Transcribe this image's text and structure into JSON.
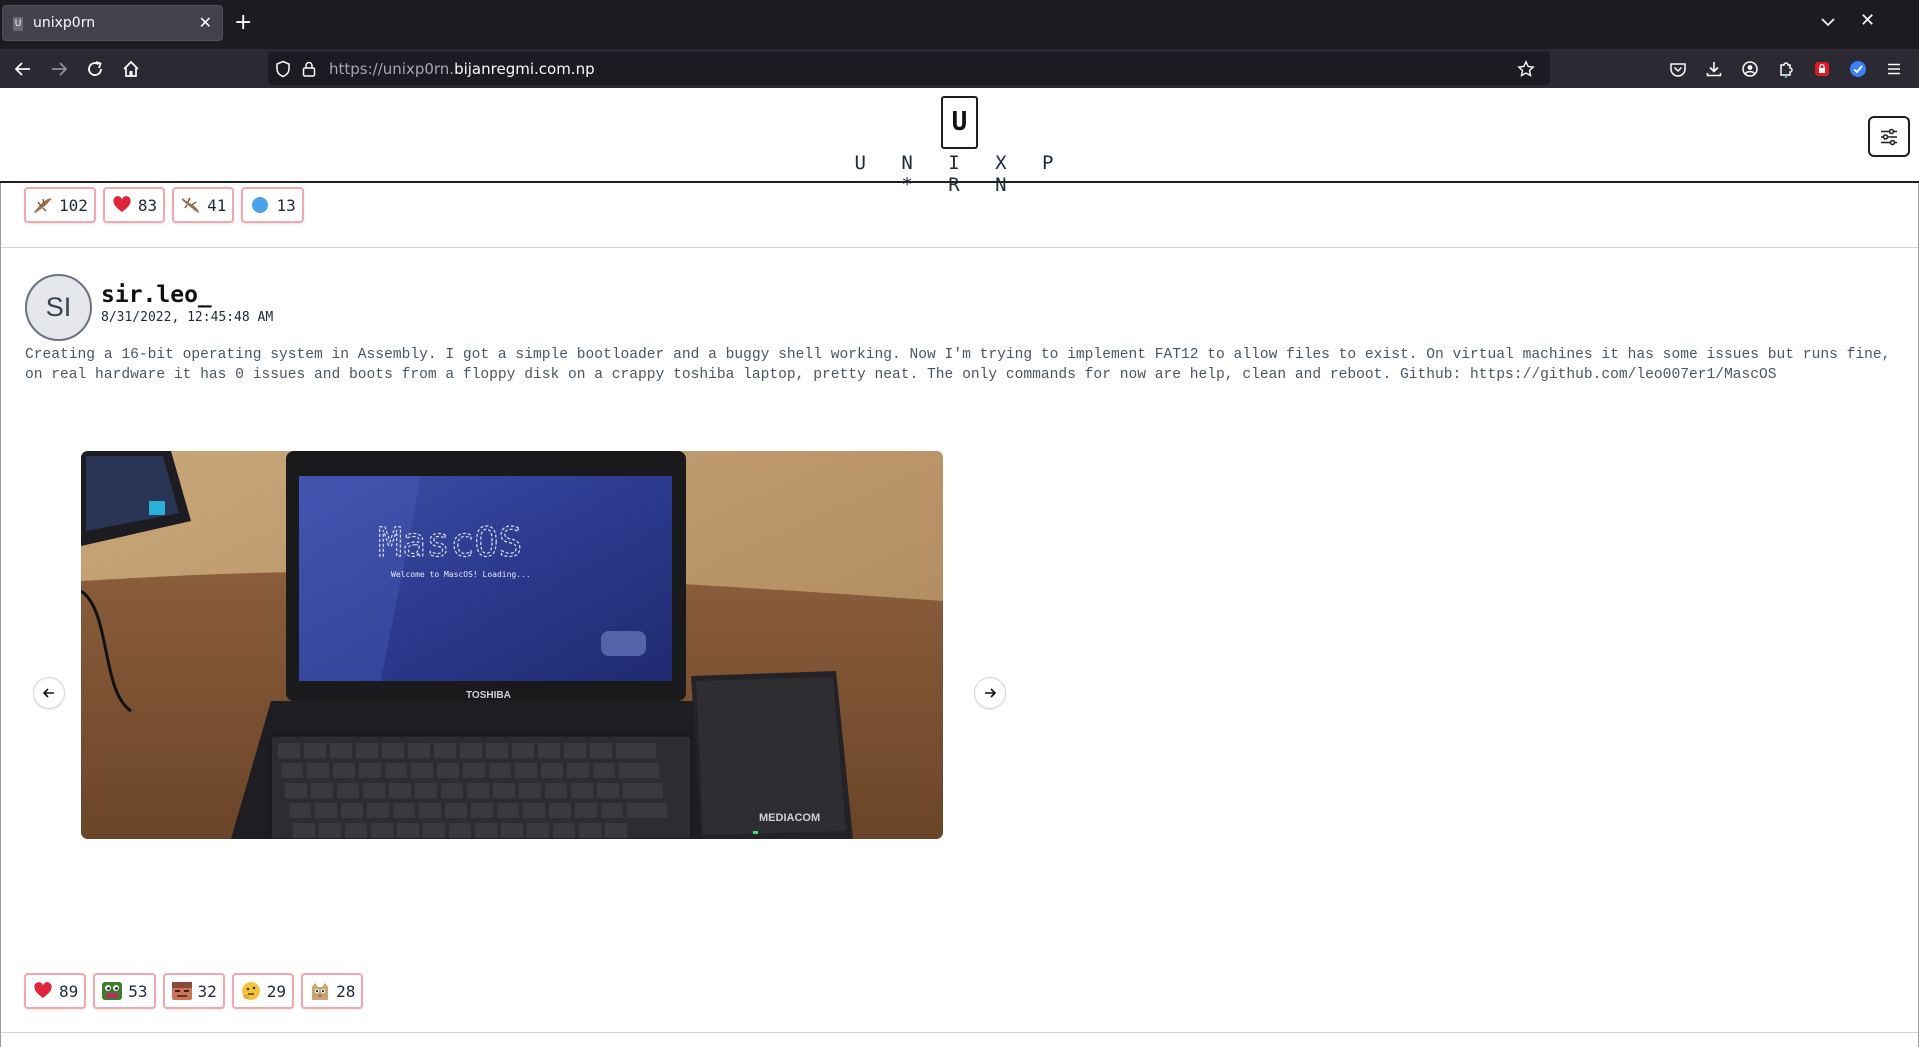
{
  "browser": {
    "tab_title": "unixp0rn",
    "url_prefix": "https://unixp0rn.",
    "url_domain": "bijanregmi.com.np"
  },
  "site": {
    "logo_letter": "U",
    "name": "U N I X P * R N"
  },
  "previous_post_reactions": [
    {
      "icon": "brown-gecko-emoji",
      "count": "102"
    },
    {
      "icon": "red-heart-emoji",
      "count": "83"
    },
    {
      "icon": "gecko-emoji",
      "count": "41"
    },
    {
      "icon": "blue-circle-emoji",
      "count": "13"
    }
  ],
  "post": {
    "avatar_initials": "SI",
    "username": "sir.leo_",
    "timestamp": "8/31/2022, 12:45:48 AM",
    "body": "Creating a 16-bit operating system in Assembly. I got a simple bootloader and a buggy shell working. Now I'm trying to implement FAT12 to allow files to exist. On virtual machines it has some issues but runs fine, on real hardware it has 0 issues and boots from a floppy disk on a crappy toshiba laptop, pretty neat. The only commands for now are help, clean and reboot. Github: https://github.com/leo007er1/MascOS",
    "image": {
      "screen_title": "MascOS",
      "screen_subtitle": "Welcome to MascOS! Loading...",
      "laptop_brand": "TOSHIBA",
      "drive_brand": "MEDIACOM"
    },
    "reactions": [
      {
        "icon": "red-heart-emoji",
        "count": "89"
      },
      {
        "icon": "pepe-frog-emoji",
        "count": "53"
      },
      {
        "icon": "face-emoji",
        "count": "32"
      },
      {
        "icon": "thinking-emoji",
        "count": "29"
      },
      {
        "icon": "cat-emoji",
        "count": "28"
      }
    ]
  }
}
